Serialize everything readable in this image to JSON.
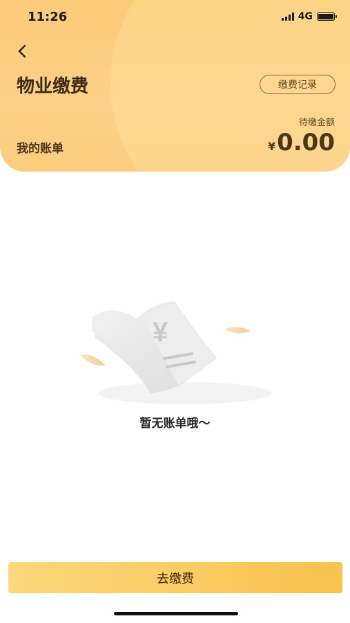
{
  "status_bar": {
    "time": "11:26",
    "network": "4G"
  },
  "header": {
    "title": "物业缴费",
    "records_button": "缴费记录",
    "my_bills": "我的账单",
    "pending_label": "待缴金额",
    "currency": "¥",
    "amount": "0.00"
  },
  "empty_state": {
    "message": "暂无账单哦～"
  },
  "footer": {
    "pay_button": "去缴费"
  },
  "colors": {
    "header": "#fccb78",
    "button": "#f9c34e"
  }
}
